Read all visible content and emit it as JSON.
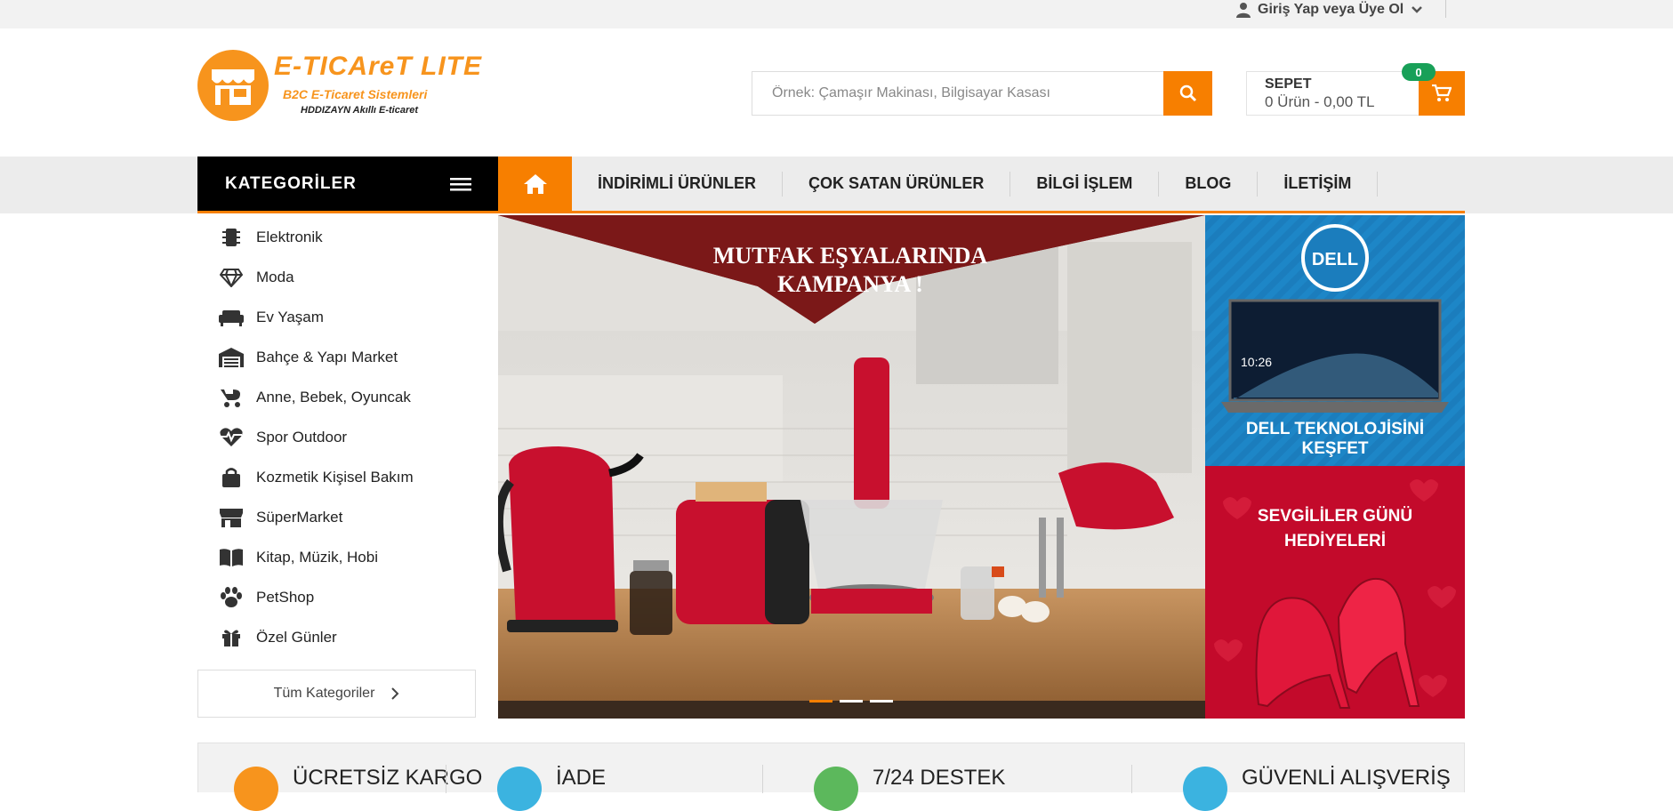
{
  "topbar": {
    "login_label": "Giriş Yap veya Üye Ol",
    "icons": [
      "user-icon",
      "chevron-down-icon"
    ]
  },
  "logo": {
    "brand": "E-TICAreT LITE",
    "subtitle": "B2C E-Ticaret Sistemleri",
    "tagline": "HDDIZAYN Akıllı E-ticaret"
  },
  "search": {
    "placeholder": "Örnek: Çamaşır Makinası, Bilgisayar Kasası",
    "value": "",
    "icon": "search-icon"
  },
  "cart": {
    "title": "SEPET",
    "summary": "0 Ürün - 0,00 TL",
    "count": "0",
    "icon": "cart-icon"
  },
  "nav": {
    "categories_label": "KATEGORİLER",
    "home_icon": "home-icon",
    "items": [
      {
        "label": "İNDİRİMLİ ÜRÜNLER"
      },
      {
        "label": "ÇOK SATAN ÜRÜNLER"
      },
      {
        "label": "BİLGİ İŞLEM"
      },
      {
        "label": "BLOG"
      },
      {
        "label": "İLETİŞİM"
      }
    ]
  },
  "categories": [
    {
      "label": "Elektronik",
      "icon": "chip-icon"
    },
    {
      "label": "Moda",
      "icon": "diamond-icon"
    },
    {
      "label": "Ev Yaşam",
      "icon": "sofa-icon"
    },
    {
      "label": "Bahçe & Yapı Market",
      "icon": "warehouse-icon"
    },
    {
      "label": "Anne, Bebek, Oyuncak",
      "icon": "stroller-icon"
    },
    {
      "label": "Spor Outdoor",
      "icon": "heartbeat-icon"
    },
    {
      "label": "Kozmetik Kişisel Bakım",
      "icon": "bag-icon"
    },
    {
      "label": "SüperMarket",
      "icon": "store-icon"
    },
    {
      "label": "Kitap, Müzik, Hobi",
      "icon": "book-icon"
    },
    {
      "label": "PetShop",
      "icon": "paw-icon"
    },
    {
      "label": "Özel Günler",
      "icon": "gift-icon"
    }
  ],
  "all_categories_label": "Tüm Kategoriler",
  "slider": {
    "headline_1": "MUTFAK EŞYALARINDA",
    "headline_2": "KAMPANYA !",
    "dots": 3,
    "active_dot": 1
  },
  "promos": [
    {
      "brand": "DELL",
      "screen_time": "10:26",
      "line1": "DELL TEKNOLOJİSİNİ",
      "line2": "KEŞFET"
    },
    {
      "line1": "SEVGİLİLER GÜNÜ",
      "line2": "HEDİYELERİ"
    }
  ],
  "features": [
    {
      "label": "ÜCRETSİZ KARGO",
      "color": "#f7941d",
      "icon": "truck-icon"
    },
    {
      "label": "İADE",
      "color": "#3bb3e0",
      "icon": "return-icon"
    },
    {
      "label": "7/24 DESTEK",
      "color": "#5cb85c",
      "icon": "support-icon"
    },
    {
      "label": "GÜVENLİ ALIŞVERİŞ",
      "color": "#3bb3e0",
      "icon": "shield-icon"
    }
  ],
  "colors": {
    "accent": "#f77f00",
    "badge": "#18a058",
    "nav_bg": "#ececec",
    "categories_bg": "#000000"
  }
}
